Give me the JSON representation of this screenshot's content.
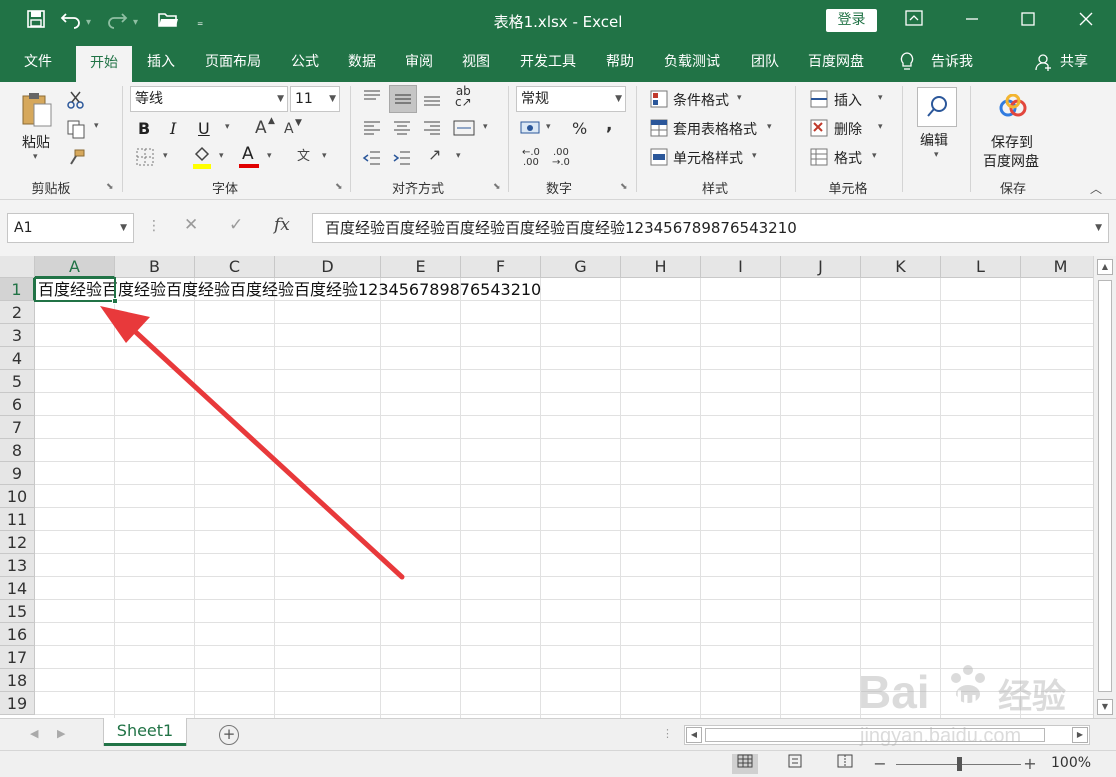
{
  "colors": {
    "accent": "#217346",
    "ribbon_bg": "#f3f3f3",
    "arrow": "#e8393b"
  },
  "quick_access": {
    "save_icon": "save-icon",
    "undo_icon": "undo-icon",
    "redo_icon": "redo-icon",
    "open_icon": "folder-icon",
    "customize_icon": "customize-icon"
  },
  "window": {
    "title": "表格1.xlsx  -  Excel",
    "login_label": "登录",
    "controls": {
      "ribbon_display": "ribbon-display-icon",
      "minimize": "minimize-icon",
      "maximize": "maximize-icon",
      "close": "close-icon"
    }
  },
  "tabs": [
    {
      "label": "文件"
    },
    {
      "label": "开始"
    },
    {
      "label": "插入"
    },
    {
      "label": "页面布局"
    },
    {
      "label": "公式"
    },
    {
      "label": "数据"
    },
    {
      "label": "审阅"
    },
    {
      "label": "视图"
    },
    {
      "label": "开发工具"
    },
    {
      "label": "帮助"
    },
    {
      "label": "负载测试"
    },
    {
      "label": "团队"
    },
    {
      "label": "百度网盘"
    }
  ],
  "tell_me": "告诉我",
  "share": "共享",
  "ribbon": {
    "clipboard": {
      "label": "剪贴板",
      "paste": "粘贴"
    },
    "font": {
      "label": "字体",
      "font_name": "等线",
      "font_size": "11",
      "bold": "B",
      "italic": "I",
      "underline": "U",
      "grow": "A",
      "shrink": "A",
      "font_color": "A",
      "wen": "文"
    },
    "alignment": {
      "label": "对齐方式"
    },
    "number": {
      "label": "数字",
      "format": "常规",
      "percent": "%",
      "comma": ","
    },
    "styles": {
      "label": "样式",
      "conditional": "条件格式",
      "table": "套用表格格式",
      "cell_styles": "单元格样式"
    },
    "cells": {
      "label": "单元格",
      "insert": "插入",
      "delete": "删除",
      "format": "格式"
    },
    "editing": {
      "label": "编辑"
    },
    "save": {
      "label": "保存",
      "button_line1": "保存到",
      "button_line2": "百度网盘"
    }
  },
  "formula_bar": {
    "name_box": "A1",
    "fx": "fx",
    "content": "百度经验百度经验百度经验百度经验百度经验123456789876543210"
  },
  "columns": [
    "A",
    "B",
    "C",
    "D",
    "E",
    "F",
    "G",
    "H",
    "I",
    "J",
    "K",
    "L",
    "M"
  ],
  "rows": [
    "1",
    "2",
    "3",
    "4",
    "5",
    "6",
    "7",
    "8",
    "9",
    "10",
    "11",
    "12",
    "13",
    "14",
    "15",
    "16",
    "17",
    "18",
    "19"
  ],
  "cells": {
    "A1": "百度经验百度经验百度经验百度经验百度经验123456789876543210"
  },
  "sheets": [
    {
      "name": "Sheet1",
      "active": true
    }
  ],
  "add_sheet": "+",
  "status": {
    "zoom": "100%",
    "zoom_level": 1.0
  }
}
